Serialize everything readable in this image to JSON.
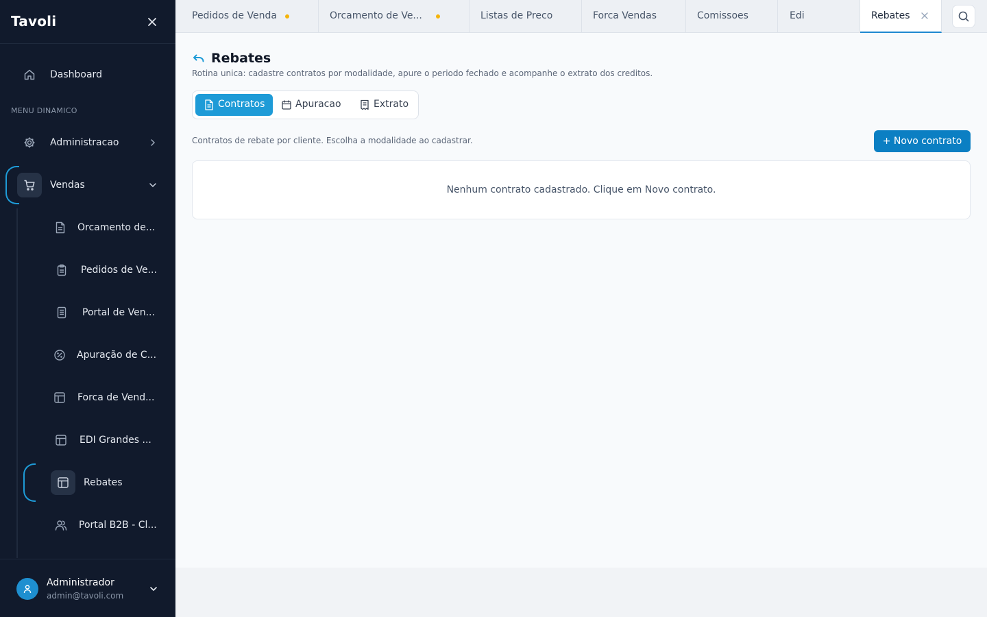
{
  "app": {
    "brand": "Tavoli"
  },
  "sidebar": {
    "dashboard_label": "Dashboard",
    "menu_caption": "MENU DINAMICO",
    "groups": {
      "admin_label": "Administracao",
      "vendas_label": "Vendas"
    },
    "sub_items": [
      {
        "label": "Orcamento de...",
        "icon": "document-icon"
      },
      {
        "label": "Pedidos de Ve...",
        "icon": "clipboard-icon"
      },
      {
        "label": "Portal de Ven...",
        "icon": "file-lines-icon"
      },
      {
        "label": "Apuração de C...",
        "icon": "percent-circle-icon"
      },
      {
        "label": "Forca de Vend...",
        "icon": "layout-icon"
      },
      {
        "label": "EDI Grandes ...",
        "icon": "layout-icon"
      },
      {
        "label": "Rebates",
        "icon": "layout-icon",
        "active": true
      },
      {
        "label": "Portal B2B - Cl...",
        "icon": "users-icon"
      }
    ],
    "user": {
      "name": "Administrador",
      "email": "admin@tavoli.com"
    }
  },
  "tabs": [
    {
      "label": "Pedidos de Venda",
      "modified": true
    },
    {
      "label": "Orcamento de Ve...",
      "modified": true
    },
    {
      "label": "Listas de Preco",
      "modified": false
    },
    {
      "label": "Forca Vendas",
      "modified": false
    },
    {
      "label": "Comissoes",
      "modified": false
    },
    {
      "label": "Edi",
      "modified": false
    },
    {
      "label": "Rebates",
      "modified": false,
      "active": true
    }
  ],
  "page": {
    "title": "Rebates",
    "subtitle": "Rotina unica: cadastre contratos por modalidade, apure o periodo fechado e acompanhe o extrato dos creditos.",
    "segments": [
      {
        "label": "Contratos",
        "active": true
      },
      {
        "label": "Apuracao",
        "active": false
      },
      {
        "label": "Extrato",
        "active": false
      }
    ],
    "section_desc": "Contratos de rebate por cliente. Escolha a modalidade ao cadastrar.",
    "new_button": "+ Novo contrato",
    "empty_message": "Nenhum contrato cadastrado. Clique em Novo contrato."
  },
  "colors": {
    "sidebar_bg": "#111a2c",
    "accent": "#1e9bd7",
    "primary_button": "#0b7fc3",
    "modified_dot": "#f5b40a"
  }
}
